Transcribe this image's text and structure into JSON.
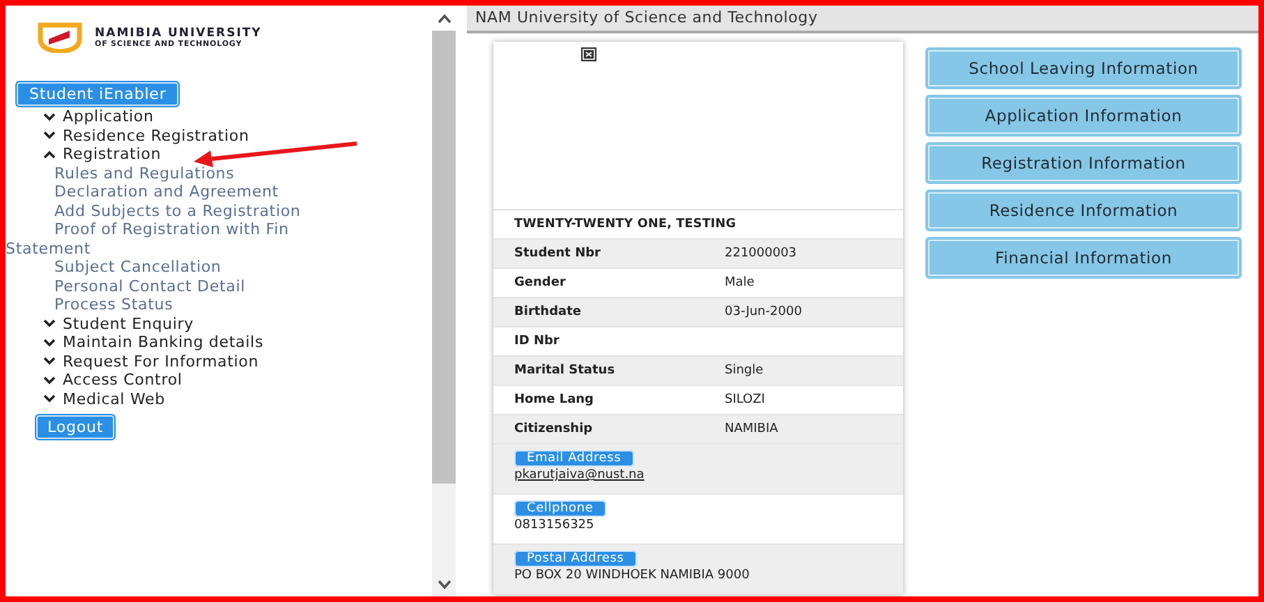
{
  "logo": {
    "name": "NAMIBIA UNIVERSITY",
    "subtitle": "OF SCIENCE AND TECHNOLOGY"
  },
  "sidebar": {
    "top_button": "Student iEnabler",
    "items": [
      {
        "label": "Application",
        "expanded": false
      },
      {
        "label": "Residence Registration",
        "expanded": false
      },
      {
        "label": "Registration",
        "expanded": true,
        "children": [
          {
            "label": "Rules and Regulations"
          },
          {
            "label": "Declaration and Agreement"
          },
          {
            "label": "Add Subjects to a Registration"
          },
          {
            "label": "Proof of Registration with Fin Statement"
          },
          {
            "label": "Subject Cancellation"
          },
          {
            "label": "Personal Contact Detail"
          },
          {
            "label": "Process Status"
          }
        ]
      },
      {
        "label": "Student Enquiry",
        "expanded": false
      },
      {
        "label": "Maintain Banking details",
        "expanded": false
      },
      {
        "label": "Request For Information",
        "expanded": false
      },
      {
        "label": "Access Control",
        "expanded": false
      },
      {
        "label": "Medical Web",
        "expanded": false
      }
    ],
    "logout_button": "Logout"
  },
  "header": {
    "title": "NAM University of Science and Technology"
  },
  "profile": {
    "name": "TWENTY-TWENTY ONE, TESTING",
    "fields": [
      {
        "label": "Student Nbr",
        "value": "221000003"
      },
      {
        "label": "Gender",
        "value": "Male"
      },
      {
        "label": "Birthdate",
        "value": "03-Jun-2000"
      },
      {
        "label": "ID Nbr"
      },
      {
        "label": "Marital Status",
        "value": "Single"
      },
      {
        "label": "Home Lang",
        "value": "SILOZI"
      },
      {
        "label": "Citizenship",
        "value": "NAMIBIA"
      }
    ],
    "contacts": [
      {
        "label": "Email Address",
        "value": "pkarutjaiva@nust.na",
        "kind": "link"
      },
      {
        "label": "Cellphone",
        "value": "0813156325",
        "kind": "text"
      },
      {
        "label": "Postal Address",
        "value": "PO BOX 20 WINDHOEK NAMIBIA 9000",
        "kind": "text"
      }
    ]
  },
  "info_buttons": [
    "School Leaving Information",
    "Application Information",
    "Registration Information",
    "Residence Information",
    "Financial Information"
  ]
}
